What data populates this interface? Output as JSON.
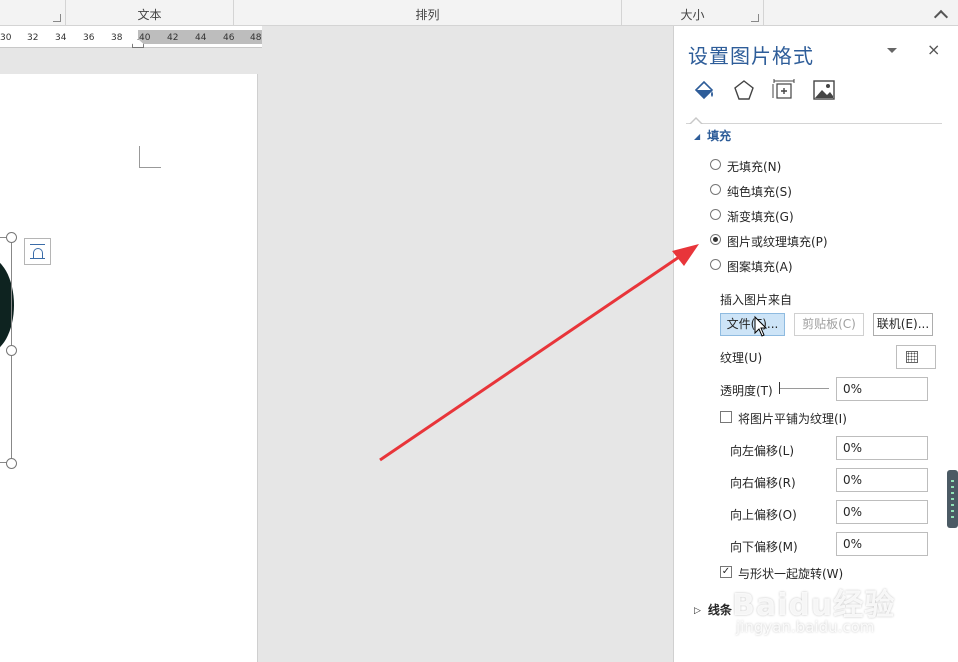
{
  "ribbon": {
    "groups": [
      "文本",
      "排列",
      "大小"
    ]
  },
  "ruler": {
    "ticks": [
      "30",
      "32",
      "34",
      "36",
      "38",
      "40",
      "42",
      "44",
      "46",
      "48"
    ]
  },
  "pane": {
    "title": "设置图片格式",
    "close": "×",
    "tabs": [
      "fill-line-icon",
      "effects-pentagon-icon",
      "layout-size-icon",
      "picture-icon"
    ],
    "fill_section": "填充",
    "fill_options": [
      "无填充(N)",
      "纯色填充(S)",
      "渐变填充(G)",
      "图片或纹理填充(P)",
      "图案填充(A)"
    ],
    "selected_fill": "图片或纹理填充(P)",
    "insert_from": "插入图片来自",
    "btn_file": "文件(F)...",
    "btn_clipboard": "剪贴板(C)",
    "btn_online": "联机(E)...",
    "texture_label": "纹理(U)",
    "transparency_label": "透明度(T)",
    "transparency_value": "0%",
    "tile_label": "将图片平铺为纹理(I)",
    "tile_checked": false,
    "offset_left_label": "向左偏移(L)",
    "offset_left": "0%",
    "offset_right_label": "向右偏移(R)",
    "offset_right": "0%",
    "offset_top_label": "向上偏移(O)",
    "offset_top": "0%",
    "offset_bottom_label": "向下偏移(M)",
    "offset_bottom": "0%",
    "rotate_label": "与形状一起旋转(W)",
    "rotate_checked": true,
    "line_section": "线条"
  },
  "watermark": {
    "brand": "Baidu经验",
    "url": "jingyan.baidu.com"
  },
  "colors": {
    "accent": "#2e5d99",
    "arrow": "#e8353a"
  }
}
